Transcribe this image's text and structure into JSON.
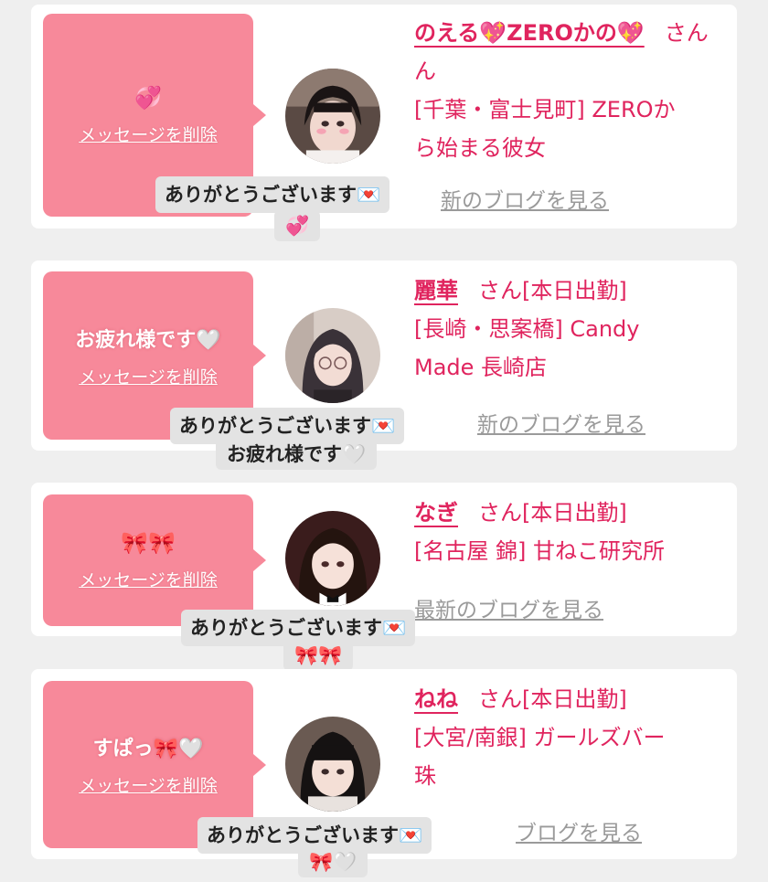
{
  "delete_label": "メッセージを削除",
  "san": "さん",
  "blog_label": "最新のブログを見る",
  "colors": {
    "accent": "#e0245e",
    "bubble": "#f7899a",
    "background": "#efefef"
  },
  "cards": [
    {
      "bubble_message": "💞",
      "name": "のえる💖ZEROかの💖",
      "status": "",
      "shop_line1": "ん",
      "shop_line2": "[千葉・富士見町] ZEROか",
      "shop_line3": "ら始まる彼女",
      "blog_visible": "新のブログを見る",
      "reply_line1": "ありがとうございます💌",
      "reply_line2": "💞"
    },
    {
      "bubble_message": "お疲れ様です🤍",
      "name": "麗華",
      "status": "[本日出勤]",
      "shop_line1": "[長崎・思案橋] Candy",
      "shop_line2": "Made 長崎店",
      "shop_line3": "",
      "blog_visible": "新のブログを見る",
      "reply_line1": "ありがとうございます💌",
      "reply_line2": "お疲れ様です🤍"
    },
    {
      "bubble_message": "🎀🎀",
      "name": "なぎ",
      "status": "[本日出勤]",
      "shop_line1": "[名古屋 錦] 甘ねこ研究所",
      "shop_line2": "",
      "shop_line3": "",
      "blog_visible": "最新のブログを見る",
      "reply_line1": "ありがとうございます💌",
      "reply_line2": "🎀🎀"
    },
    {
      "bubble_message": "すぱっ🎀🤍",
      "name": "ねね",
      "status": "[本日出勤]",
      "shop_line1": "[大宮/南銀] ガールズバー",
      "shop_line2": "珠",
      "shop_line3": "",
      "blog_visible": "ブログを見る",
      "reply_line1": "ありがとうございます💌",
      "reply_line2": "🎀🤍"
    }
  ]
}
